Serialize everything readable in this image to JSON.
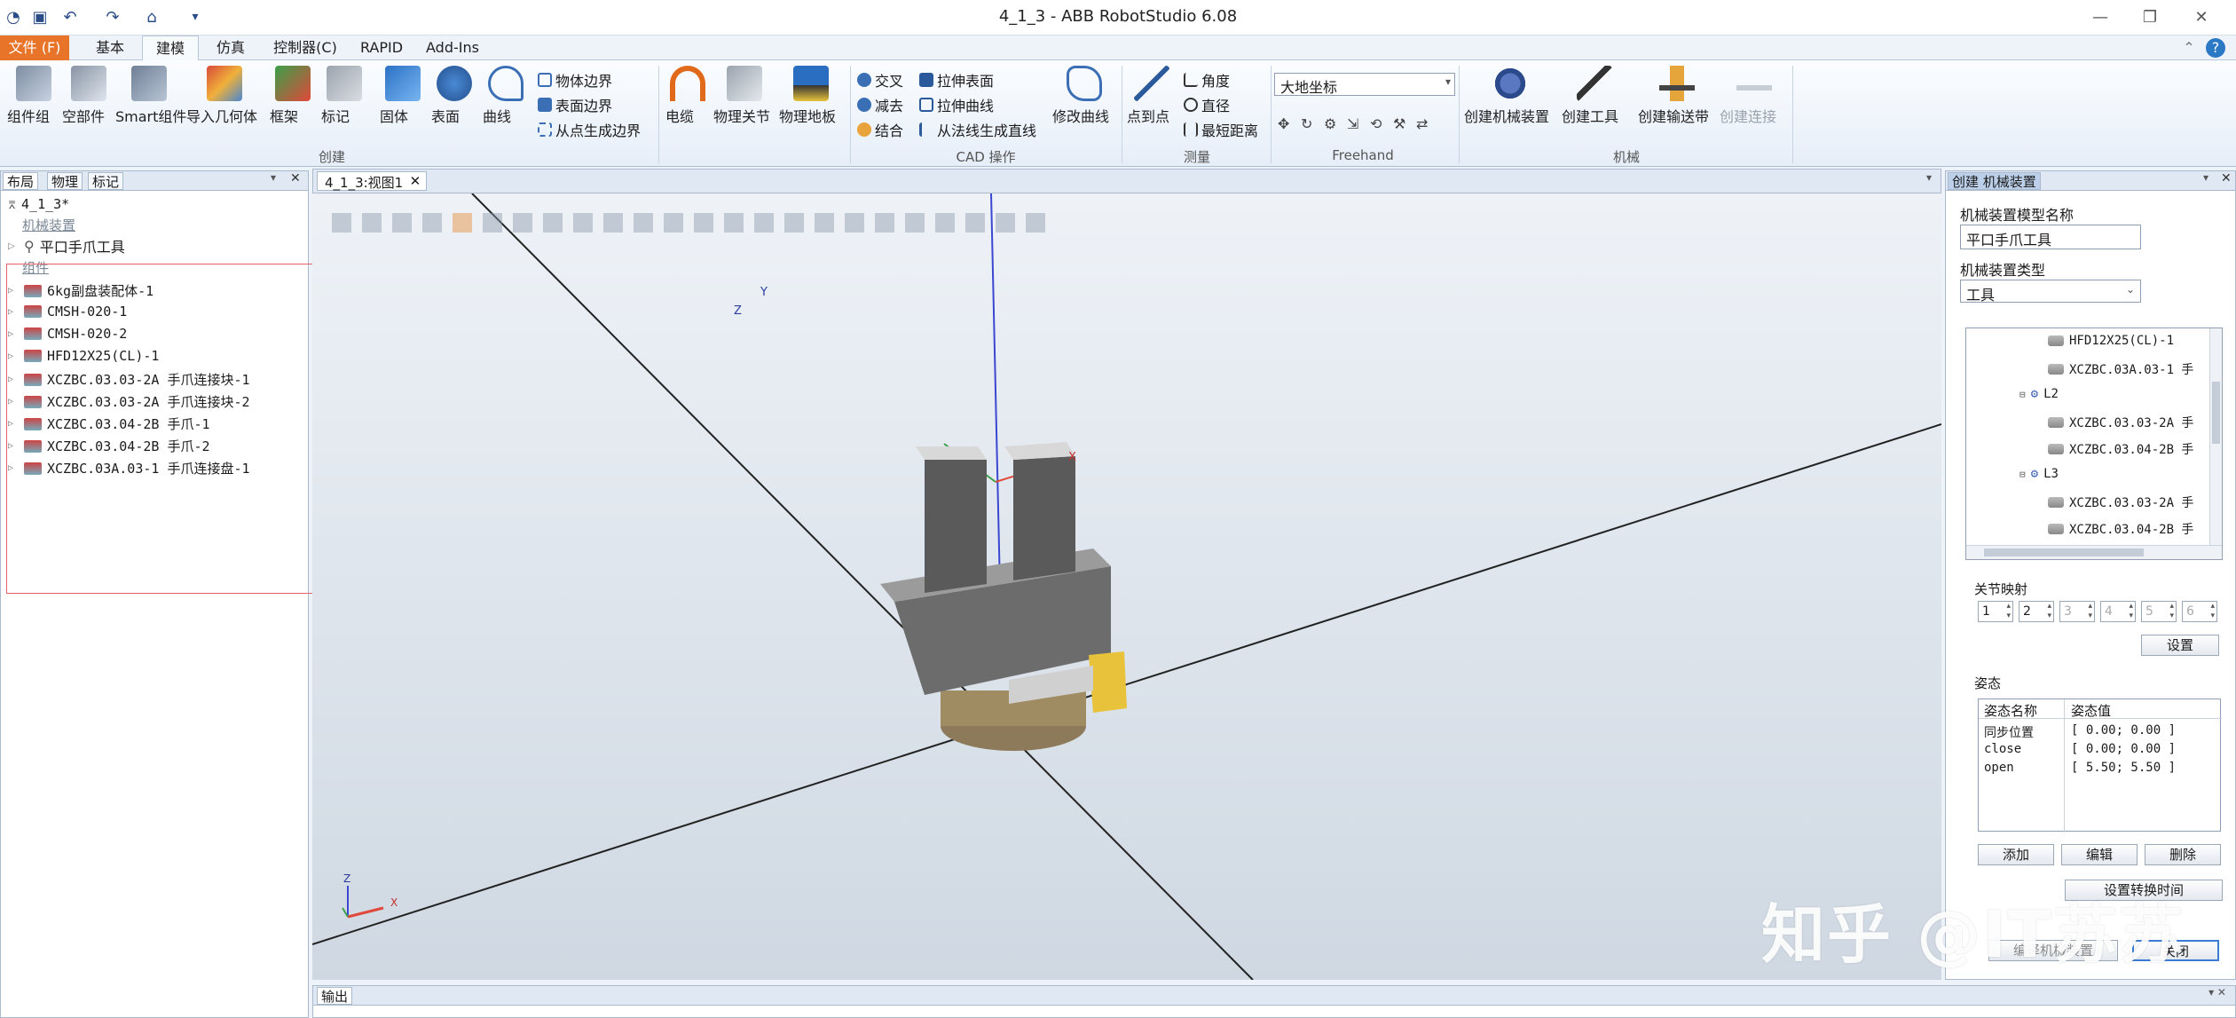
{
  "window": {
    "title": "4_1_3 - ABB RobotStudio 6.08",
    "controls": [
      "minimize-icon",
      "restore-icon",
      "close-icon"
    ]
  },
  "ribbon_tabs": [
    {
      "label": "文件 (F)",
      "active": false
    },
    {
      "label": "基本",
      "active": false
    },
    {
      "label": "建模",
      "active": true
    },
    {
      "label": "仿真",
      "active": false
    },
    {
      "label": "控制器(C)",
      "active": false
    },
    {
      "label": "RAPID",
      "active": false
    },
    {
      "label": "Add-Ins",
      "active": false
    }
  ],
  "ribbon": {
    "create": {
      "group_label": "创建",
      "buttons": [
        "组件组",
        "空部件",
        "Smart组件",
        "导入几何体",
        "框架",
        "标记",
        "固体",
        "表面",
        "曲线"
      ],
      "small": [
        "物体边界",
        "表面边界",
        "从点生成边界"
      ]
    },
    "physics": {
      "buttons": [
        "电缆",
        "物理关节",
        "物理地板"
      ]
    },
    "cad": {
      "group_label": "CAD 操作",
      "small": [
        "交叉",
        "减去",
        "结合",
        "拉伸表面",
        "拉伸曲线",
        "从法线生成直线"
      ],
      "modify": "修改曲线"
    },
    "measure": {
      "group_label": "测量",
      "point_to_point": "点到点",
      "small": [
        "角度",
        "直径",
        "最短距离"
      ]
    },
    "freehand": {
      "group_label": "Freehand",
      "dropdown": "大地坐标"
    },
    "mechanism": {
      "group_label": "机械",
      "buttons": [
        "创建机械装置",
        "创建工具",
        "创建输送带",
        "创建连接"
      ]
    }
  },
  "left_panel": {
    "tabs": [
      "布局",
      "物理",
      "标记"
    ],
    "root": "4_1_3*",
    "section_mechanism": "机械装置",
    "mechanism_item": "平口手爪工具",
    "section_components": "组件",
    "components": [
      "6kg副盘装配体-1",
      "CMSH-020-1",
      "CMSH-020-2",
      "HFD12X25(CL)-1",
      "XCZBC.03.03-2A 手爪连接块-1",
      "XCZBC.03.03-2A 手爪连接块-2",
      "XCZBC.03.04-2B 手爪-1",
      "XCZBC.03.04-2B 手爪-2",
      "XCZBC.03A.03-1 手爪连接盘-1"
    ]
  },
  "viewport": {
    "tab": "4_1_3:视图1",
    "axis_labels": {
      "x": "X",
      "y": "Y",
      "z": "Z"
    }
  },
  "right_panel": {
    "tab": "创建 机械装置",
    "model_name_label": "机械装置模型名称",
    "model_name_value": "平口手爪工具",
    "type_label": "机械装置类型",
    "type_value": "工具",
    "tree": [
      {
        "text": "HFD12X25(CL)-1",
        "indent": 2,
        "kind": "part"
      },
      {
        "text": "XCZBC.03A.03-1 手",
        "indent": 2,
        "kind": "part"
      },
      {
        "text": "L2",
        "indent": 1,
        "kind": "link"
      },
      {
        "text": "XCZBC.03.03-2A 手",
        "indent": 2,
        "kind": "part"
      },
      {
        "text": "XCZBC.03.04-2B 手",
        "indent": 2,
        "kind": "part"
      },
      {
        "text": "L3",
        "indent": 1,
        "kind": "link"
      },
      {
        "text": "XCZBC.03.03-2A 手",
        "indent": 2,
        "kind": "part"
      },
      {
        "text": "XCZBC.03.04-2B 手",
        "indent": 2,
        "kind": "part"
      }
    ],
    "joint_mapping_label": "关节映射",
    "joint_spinners": [
      "1",
      "2",
      "3",
      "4",
      "5",
      "6"
    ],
    "set_button": "设置",
    "pose_label": "姿态",
    "pose_headers": [
      "姿态名称",
      "姿态值"
    ],
    "poses": [
      {
        "name": "同步位置",
        "value": "[ 0.00; 0.00 ]"
      },
      {
        "name": "close",
        "value": "[ 0.00; 0.00 ]"
      },
      {
        "name": "open",
        "value": "[ 5.50; 5.50 ]"
      }
    ],
    "add_button": "添加",
    "edit_button": "编辑",
    "delete_button": "删除",
    "transition_button": "设置转换时间",
    "compile_button": "编译机械装置",
    "close_button": "关闭"
  },
  "output_panel": {
    "tab": "输出"
  },
  "watermark": "知乎 @IT苏苏"
}
